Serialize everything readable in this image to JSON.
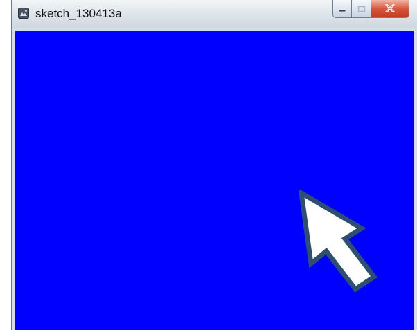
{
  "window": {
    "title": "sketch_130413a",
    "app_icon": "processing-sketch-icon",
    "caption_buttons": {
      "minimize_icon": "minimize-icon",
      "maximize_icon": "maximize-icon",
      "close_icon": "close-icon"
    }
  },
  "canvas": {
    "background": "#0000ff",
    "pointer_icon": "arrow-pointer-icon",
    "pointer_fill": "#ffffff",
    "pointer_outline": "#2f4f70"
  }
}
